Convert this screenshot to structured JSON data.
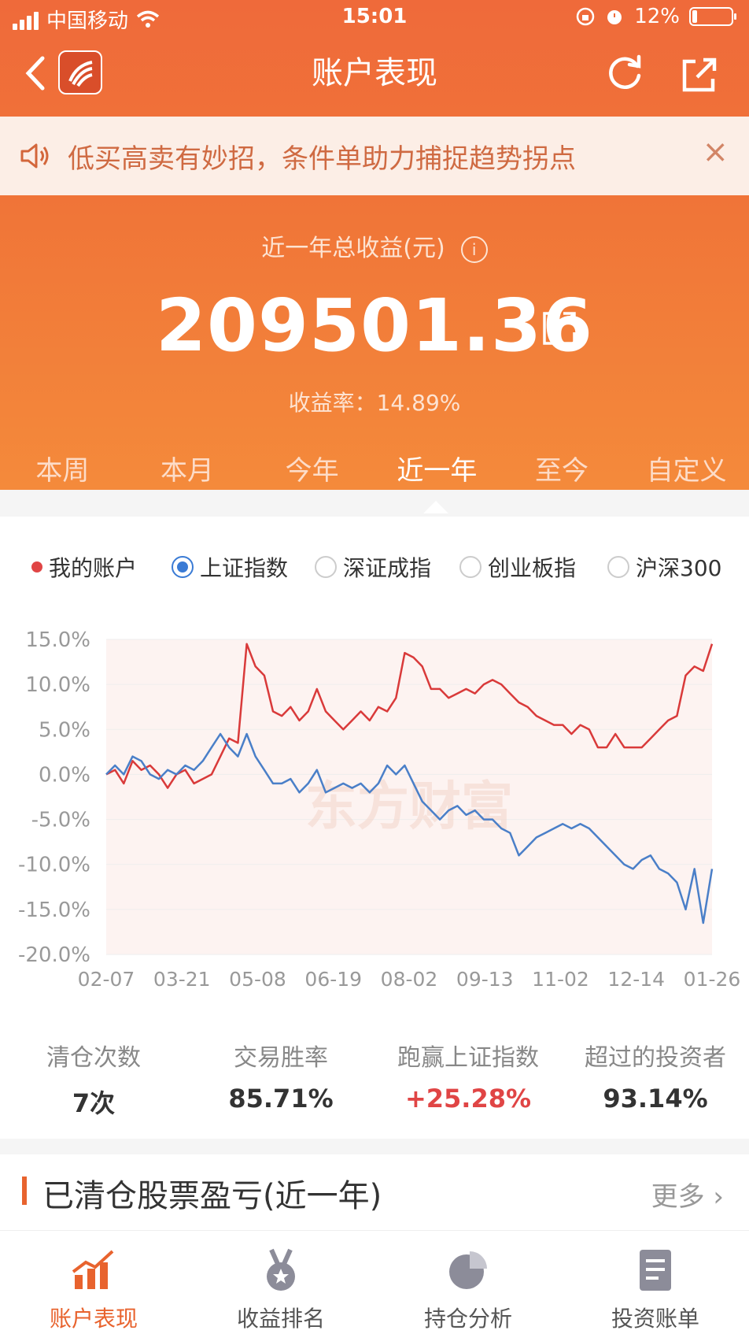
{
  "status_bar": {
    "carrier": "中国移动",
    "time": "15:01",
    "battery": "12%"
  },
  "nav": {
    "back_icon": "chevron-left-icon",
    "title": "账户表现",
    "refresh_icon": "refresh-icon",
    "share_icon": "share-icon"
  },
  "notice": {
    "text": "低买高卖有妙招，条件单助力捕捉趋势拐点",
    "close": "×"
  },
  "summary": {
    "label": "近一年总收益(元)",
    "info_icon": "info-icon",
    "total": "209501.36",
    "rate": "收益率：14.89%"
  },
  "periods": [
    "本周",
    "本月",
    "今年",
    "近一年",
    "至今",
    "自定义"
  ],
  "active_period": "近一年",
  "legend": {
    "account": "我的账户",
    "indexes": [
      "上证指数",
      "深证成指",
      "创业板指",
      "沪深300"
    ],
    "selected": "上证指数"
  },
  "chart_data": {
    "type": "line",
    "x_ticks": [
      "02-07",
      "03-21",
      "05-08",
      "06-19",
      "08-02",
      "09-13",
      "11-02",
      "12-14",
      "01-26"
    ],
    "ylim": [
      -20,
      15
    ],
    "y_ticks": [
      "15.0%",
      "10.0%",
      "5.0%",
      "0.0%",
      "-5.0%",
      "-10.0%",
      "-15.0%",
      "-20.0%"
    ],
    "grid": true,
    "watermark": "东方财富",
    "series": [
      {
        "name": "我的账户",
        "color": "#d93a3a",
        "values": [
          0,
          0.5,
          -1,
          1.5,
          0.5,
          1,
          0,
          -1.5,
          0,
          0.5,
          -1,
          -0.5,
          0,
          2,
          4,
          3.5,
          14.5,
          12,
          11,
          7,
          6.5,
          7.5,
          6,
          7,
          9.5,
          7,
          6,
          5,
          6,
          7,
          6,
          7.5,
          7,
          8.5,
          13.5,
          13,
          12,
          9.5,
          9.5,
          8.5,
          9,
          9.5,
          9,
          10,
          10.5,
          10,
          9,
          8,
          7.5,
          6.5,
          6,
          5.5,
          5.5,
          4.5,
          5.5,
          5,
          3,
          3,
          4.5,
          3,
          3,
          3,
          4,
          5,
          6,
          6.5,
          11,
          12,
          11.5,
          14.5
        ]
      },
      {
        "name": "上证指数",
        "color": "#4a7fc8",
        "values": [
          0,
          1,
          0,
          2,
          1.5,
          0,
          -0.5,
          0.5,
          0,
          1,
          0.5,
          1.5,
          3,
          4.5,
          3,
          2,
          4.5,
          2,
          0.5,
          -1,
          -1,
          -0.5,
          -2,
          -1,
          0.5,
          -2,
          -1.5,
          -1,
          -1.5,
          -1,
          -2,
          -1,
          1,
          0,
          1,
          -1,
          -3,
          -4,
          -5,
          -4,
          -3.5,
          -4.5,
          -4,
          -5,
          -5,
          -6,
          -6.5,
          -9,
          -8,
          -7,
          -6.5,
          -6,
          -5.5,
          -6,
          -5.5,
          -6,
          -7,
          -8,
          -9,
          -10,
          -10.5,
          -9.5,
          -9,
          -10.5,
          -11,
          -12,
          -15,
          -10.5,
          -16.5,
          -10.5
        ]
      }
    ]
  },
  "stats": [
    {
      "label": "清仓次数",
      "value": "7次",
      "highlight": false
    },
    {
      "label": "交易胜率",
      "value": "85.71%",
      "highlight": false
    },
    {
      "label": "跑赢上证指数",
      "value": "+25.28%",
      "highlight": true
    },
    {
      "label": "超过的投资者",
      "value": "93.14%",
      "highlight": false
    }
  ],
  "cleared": {
    "title": "已清仓股票盈亏(近一年)",
    "more": "更多 ›"
  },
  "tabbar": [
    {
      "label": "账户表现",
      "icon": "trend-chart-icon",
      "active": true
    },
    {
      "label": "收益排名",
      "icon": "medal-icon",
      "active": false
    },
    {
      "label": "持仓分析",
      "icon": "pie-chart-icon",
      "active": false
    },
    {
      "label": "投资账单",
      "icon": "bill-icon",
      "active": false
    }
  ],
  "colors": {
    "brand": "#e8632e",
    "up": "#e04545",
    "index_blue": "#3a7bd5"
  }
}
